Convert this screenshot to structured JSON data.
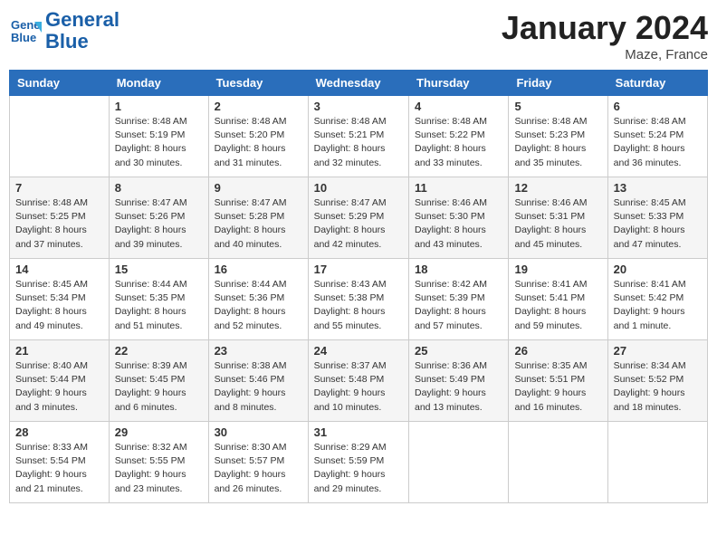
{
  "header": {
    "logo_line1": "General",
    "logo_line2": "Blue",
    "month": "January 2024",
    "location": "Maze, France"
  },
  "days_of_week": [
    "Sunday",
    "Monday",
    "Tuesday",
    "Wednesday",
    "Thursday",
    "Friday",
    "Saturday"
  ],
  "weeks": [
    [
      {
        "num": "",
        "data": ""
      },
      {
        "num": "1",
        "data": "Sunrise: 8:48 AM\nSunset: 5:19 PM\nDaylight: 8 hours\nand 30 minutes."
      },
      {
        "num": "2",
        "data": "Sunrise: 8:48 AM\nSunset: 5:20 PM\nDaylight: 8 hours\nand 31 minutes."
      },
      {
        "num": "3",
        "data": "Sunrise: 8:48 AM\nSunset: 5:21 PM\nDaylight: 8 hours\nand 32 minutes."
      },
      {
        "num": "4",
        "data": "Sunrise: 8:48 AM\nSunset: 5:22 PM\nDaylight: 8 hours\nand 33 minutes."
      },
      {
        "num": "5",
        "data": "Sunrise: 8:48 AM\nSunset: 5:23 PM\nDaylight: 8 hours\nand 35 minutes."
      },
      {
        "num": "6",
        "data": "Sunrise: 8:48 AM\nSunset: 5:24 PM\nDaylight: 8 hours\nand 36 minutes."
      }
    ],
    [
      {
        "num": "7",
        "data": "Sunrise: 8:48 AM\nSunset: 5:25 PM\nDaylight: 8 hours\nand 37 minutes."
      },
      {
        "num": "8",
        "data": "Sunrise: 8:47 AM\nSunset: 5:26 PM\nDaylight: 8 hours\nand 39 minutes."
      },
      {
        "num": "9",
        "data": "Sunrise: 8:47 AM\nSunset: 5:28 PM\nDaylight: 8 hours\nand 40 minutes."
      },
      {
        "num": "10",
        "data": "Sunrise: 8:47 AM\nSunset: 5:29 PM\nDaylight: 8 hours\nand 42 minutes."
      },
      {
        "num": "11",
        "data": "Sunrise: 8:46 AM\nSunset: 5:30 PM\nDaylight: 8 hours\nand 43 minutes."
      },
      {
        "num": "12",
        "data": "Sunrise: 8:46 AM\nSunset: 5:31 PM\nDaylight: 8 hours\nand 45 minutes."
      },
      {
        "num": "13",
        "data": "Sunrise: 8:45 AM\nSunset: 5:33 PM\nDaylight: 8 hours\nand 47 minutes."
      }
    ],
    [
      {
        "num": "14",
        "data": "Sunrise: 8:45 AM\nSunset: 5:34 PM\nDaylight: 8 hours\nand 49 minutes."
      },
      {
        "num": "15",
        "data": "Sunrise: 8:44 AM\nSunset: 5:35 PM\nDaylight: 8 hours\nand 51 minutes."
      },
      {
        "num": "16",
        "data": "Sunrise: 8:44 AM\nSunset: 5:36 PM\nDaylight: 8 hours\nand 52 minutes."
      },
      {
        "num": "17",
        "data": "Sunrise: 8:43 AM\nSunset: 5:38 PM\nDaylight: 8 hours\nand 55 minutes."
      },
      {
        "num": "18",
        "data": "Sunrise: 8:42 AM\nSunset: 5:39 PM\nDaylight: 8 hours\nand 57 minutes."
      },
      {
        "num": "19",
        "data": "Sunrise: 8:41 AM\nSunset: 5:41 PM\nDaylight: 8 hours\nand 59 minutes."
      },
      {
        "num": "20",
        "data": "Sunrise: 8:41 AM\nSunset: 5:42 PM\nDaylight: 9 hours\nand 1 minute."
      }
    ],
    [
      {
        "num": "21",
        "data": "Sunrise: 8:40 AM\nSunset: 5:44 PM\nDaylight: 9 hours\nand 3 minutes."
      },
      {
        "num": "22",
        "data": "Sunrise: 8:39 AM\nSunset: 5:45 PM\nDaylight: 9 hours\nand 6 minutes."
      },
      {
        "num": "23",
        "data": "Sunrise: 8:38 AM\nSunset: 5:46 PM\nDaylight: 9 hours\nand 8 minutes."
      },
      {
        "num": "24",
        "data": "Sunrise: 8:37 AM\nSunset: 5:48 PM\nDaylight: 9 hours\nand 10 minutes."
      },
      {
        "num": "25",
        "data": "Sunrise: 8:36 AM\nSunset: 5:49 PM\nDaylight: 9 hours\nand 13 minutes."
      },
      {
        "num": "26",
        "data": "Sunrise: 8:35 AM\nSunset: 5:51 PM\nDaylight: 9 hours\nand 16 minutes."
      },
      {
        "num": "27",
        "data": "Sunrise: 8:34 AM\nSunset: 5:52 PM\nDaylight: 9 hours\nand 18 minutes."
      }
    ],
    [
      {
        "num": "28",
        "data": "Sunrise: 8:33 AM\nSunset: 5:54 PM\nDaylight: 9 hours\nand 21 minutes."
      },
      {
        "num": "29",
        "data": "Sunrise: 8:32 AM\nSunset: 5:55 PM\nDaylight: 9 hours\nand 23 minutes."
      },
      {
        "num": "30",
        "data": "Sunrise: 8:30 AM\nSunset: 5:57 PM\nDaylight: 9 hours\nand 26 minutes."
      },
      {
        "num": "31",
        "data": "Sunrise: 8:29 AM\nSunset: 5:59 PM\nDaylight: 9 hours\nand 29 minutes."
      },
      {
        "num": "",
        "data": ""
      },
      {
        "num": "",
        "data": ""
      },
      {
        "num": "",
        "data": ""
      }
    ]
  ]
}
